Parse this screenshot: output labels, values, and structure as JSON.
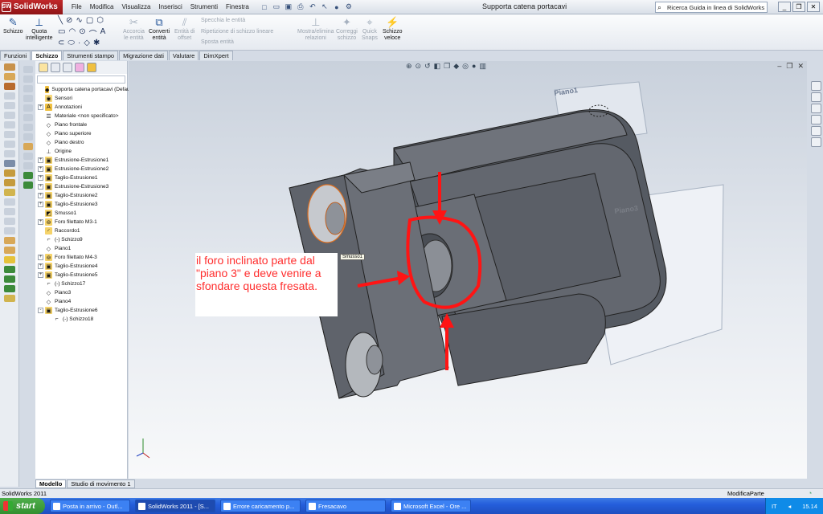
{
  "app": {
    "name": "SolidWorks",
    "logo_mark": "SW",
    "document_title": "Supporta catena portacavi"
  },
  "menu": [
    "File",
    "Modifica",
    "Visualizza",
    "Inserisci",
    "Strumenti",
    "Finestra"
  ],
  "search": {
    "placeholder": "Ricerca Guida in linea di SolidWorks"
  },
  "toolbar": {
    "schizzo": "Schizzo",
    "quota_1": "Quota",
    "quota_2": "intelligente",
    "accorcia_1": "Accorcia",
    "accorcia_2": "le entità",
    "converti_1": "Converti",
    "converti_2": "entità",
    "offset_1": "Entità di",
    "offset_2": "offset",
    "specchia": "Specchia le entità",
    "ripetizione": "Ripetizione di schizzo lineare",
    "sposta": "Sposta entità",
    "mostra_1": "Mostra/elimina",
    "mostra_2": "relazioni",
    "correggi_1": "Correggi",
    "correggi_2": "schizzo",
    "quick_1": "Quick",
    "quick_2": "Snaps",
    "veloce_1": "Schizzo",
    "veloce_2": "veloce"
  },
  "tabs": [
    "Funzioni",
    "Schizzo",
    "Strumenti stampo",
    "Migrazione dati",
    "Valutare",
    "DimXpert"
  ],
  "active_tab": "Schizzo",
  "tree": [
    {
      "label": "Supporta catena portacavi  (Default<",
      "expander": "",
      "icon": "part"
    },
    {
      "label": "Sensori",
      "expander": "",
      "icon": "sensor"
    },
    {
      "label": "Annotazioni",
      "expander": "+",
      "icon": "annot"
    },
    {
      "label": "Materiale <non specificato>",
      "expander": "",
      "icon": "material"
    },
    {
      "label": "Piano frontale",
      "expander": "",
      "icon": "plane"
    },
    {
      "label": "Piano superiore",
      "expander": "",
      "icon": "plane"
    },
    {
      "label": "Piano destro",
      "expander": "",
      "icon": "plane"
    },
    {
      "label": "Origine",
      "expander": "",
      "icon": "origin"
    },
    {
      "label": "Estrusione-Estrusione1",
      "expander": "+",
      "icon": "feature"
    },
    {
      "label": "Estrusione-Estrusione2",
      "expander": "+",
      "icon": "feature"
    },
    {
      "label": "Taglio-Estrusione1",
      "expander": "+",
      "icon": "feature"
    },
    {
      "label": "Estrusione-Estrusione3",
      "expander": "+",
      "icon": "feature"
    },
    {
      "label": "Taglio-Estrusione2",
      "expander": "+",
      "icon": "feature"
    },
    {
      "label": "Taglio-Estrusione3",
      "expander": "+",
      "icon": "feature"
    },
    {
      "label": "Smusso1",
      "expander": "",
      "icon": "chamfer"
    },
    {
      "label": "Foro filettato M3-1",
      "expander": "+",
      "icon": "hole"
    },
    {
      "label": "Raccordo1",
      "expander": "",
      "icon": "fillet"
    },
    {
      "label": "(-) Schizzo9",
      "expander": "",
      "icon": "sketch"
    },
    {
      "label": "Piano1",
      "expander": "",
      "icon": "plane"
    },
    {
      "label": "Foro filettato M4-3",
      "expander": "+",
      "icon": "hole"
    },
    {
      "label": "Taglio-Estrusione4",
      "expander": "+",
      "icon": "feature"
    },
    {
      "label": "Taglio-Estrusione5",
      "expander": "+",
      "icon": "feature"
    },
    {
      "label": "(-) Schizzo17",
      "expander": "",
      "icon": "sketch"
    },
    {
      "label": "Piano3",
      "expander": "",
      "icon": "plane"
    },
    {
      "label": "Piano4",
      "expander": "",
      "icon": "plane"
    },
    {
      "label": "Taglio-Estrusione6",
      "expander": "-",
      "icon": "feature"
    },
    {
      "label": "(-) Schizzo18",
      "expander": "",
      "icon": "sketch",
      "child": true
    }
  ],
  "bottom_tabs": [
    "Modello",
    "Studio di movimento 1"
  ],
  "viewport": {
    "plane1_label": "Piano1",
    "plane3_label": "Piano3",
    "tooltip": "Smusso1",
    "annotation": "il foro inclinato parte dal \"piano 3\" e deve venire a sfondare questa fresata."
  },
  "status": {
    "left": "SolidWorks 2011",
    "right": "ModificaParte"
  },
  "taskbar": {
    "start": "start",
    "buttons": [
      "Posta in arrivo - Outl...",
      "SolidWorks 2011 - [S...",
      "Errore caricamento p...",
      "Fresacavo",
      "Microsoft Excel - Ore ..."
    ],
    "active_index": 1,
    "lang": "IT",
    "time": "15.14"
  },
  "colors": {
    "annotation": "#ff2e2e",
    "model": "#5f636b",
    "taskbar": "#245edb"
  }
}
